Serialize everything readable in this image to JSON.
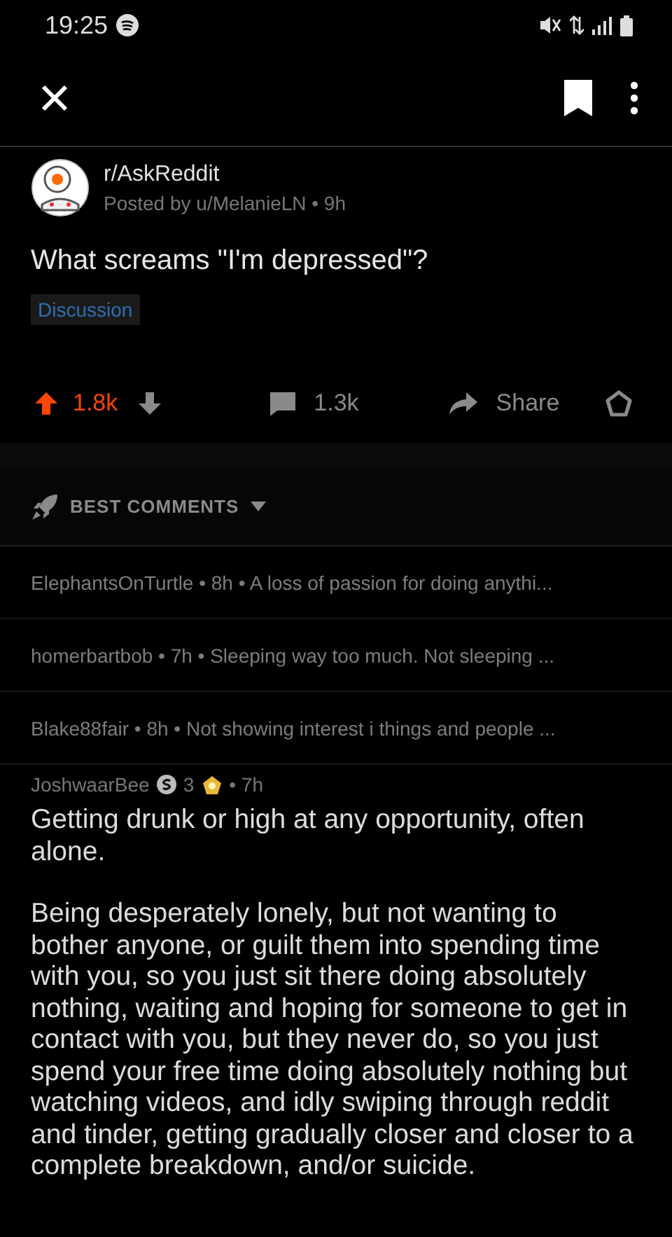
{
  "status_bar": {
    "time": "19:25"
  },
  "post": {
    "subreddit": "r/AskReddit",
    "byline": "Posted by u/MelanieLN • 9h",
    "title": "What screams \"I'm depressed\"?",
    "flair": "Discussion"
  },
  "actions": {
    "upvoted": true,
    "score": "1.8k",
    "comments": "1.3k",
    "share": "Share"
  },
  "sort": {
    "label": "BEST COMMENTS"
  },
  "collapsed_comments": [
    {
      "line": "ElephantsOnTurtle • 8h • A loss of passion for doing anythi..."
    },
    {
      "line": "homerbartbob • 7h • Sleeping way too much.  Not sleeping ..."
    },
    {
      "line": "Blake88fair • 8h • Not showing interest i things and people ..."
    }
  ],
  "comment": {
    "author": "JoshwaarBee",
    "coins": "3",
    "time": "• 7h",
    "paragraphs": [
      "Getting drunk or high at any opportunity, often alone.",
      "Being desperately lonely, but not wanting to bother anyone, or guilt them into spending time with you, so you just sit there doing absolutely nothing, waiting and hoping for someone to get in contact with you, but they never do, so you just spend your free time doing absolutely nothing but watching videos, and idly swiping through reddit and tinder, getting gradually closer and closer to a complete breakdown, and/or suicide."
    ]
  }
}
